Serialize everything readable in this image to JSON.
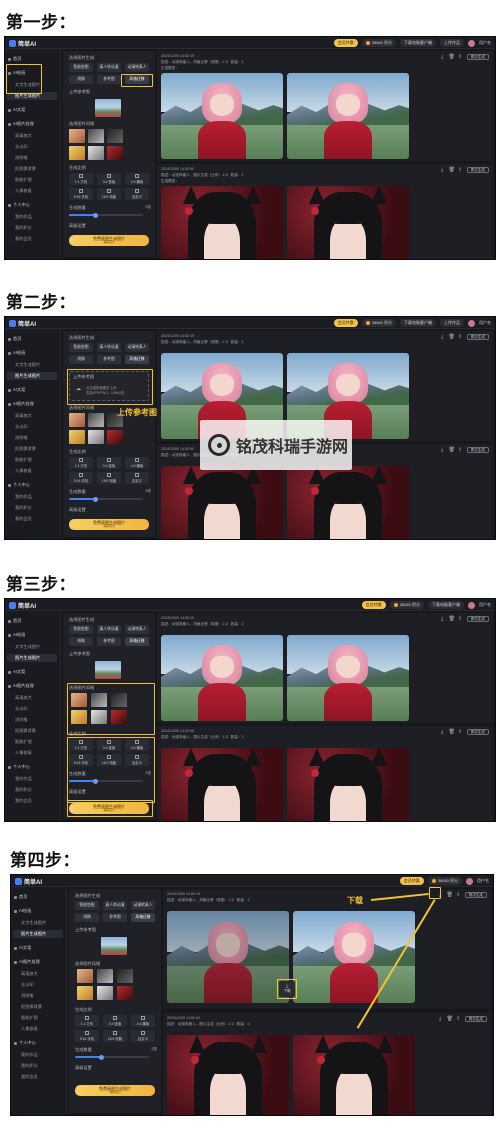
{
  "steps": [
    {
      "title": "第一步："
    },
    {
      "title": "第二步："
    },
    {
      "title": "第三步："
    },
    {
      "title": "第四步："
    }
  ],
  "app": {
    "name": "简单AI",
    "top_pill_membership": "会员特惠",
    "top_credits": "38683 积分",
    "top_download_client": "下载电脑客户端",
    "top_upload": "上传作品",
    "top_user": "用户名"
  },
  "sidebar": {
    "items": [
      {
        "label": "首页"
      },
      {
        "label": "AI绘画"
      },
      {
        "label": "文字生成图片"
      },
      {
        "label": "图片生成图片"
      },
      {
        "label": "AI文案"
      },
      {
        "label": "AI图片处理"
      },
      {
        "label": "高清放大"
      },
      {
        "label": "去水印"
      },
      {
        "label": "消除笔"
      },
      {
        "label": "抠图换背景"
      },
      {
        "label": "智能扩图"
      },
      {
        "label": "人像修复"
      },
      {
        "label": "个人中心"
      },
      {
        "label": "我的作品"
      },
      {
        "label": "我的积分"
      },
      {
        "label": "我的会员"
      }
    ]
  },
  "panel": {
    "section_title": "选择图片生成",
    "chips": [
      "智能垫图",
      "真人转动漫",
      "动漫转真人",
      "线稿",
      "参考图",
      "风格迁移"
    ],
    "ref_label": "上传参考图",
    "upload_hint_1": "点击或拖拽图片上传",
    "upload_hint_2": "支持JPG/PNG，10M以内",
    "style_label": "选择图片风格",
    "ratio_label": "生成比例",
    "ratios": [
      "1:1 方形",
      "3:4 竖版",
      "4:3 横版",
      "9:16 手机",
      "16:9 电脑",
      "自定义"
    ],
    "count_label": "生成数量",
    "count_value": "2张",
    "advanced_label": "高级设置",
    "generate_label": "免费画图生成图片",
    "generate_sub": "消耗积分"
  },
  "results": {
    "card1_time": "2024/12/09 14:52:19",
    "card1_desc": "描述：动漫风格人，风格迁移（原图：1:1）数量：2",
    "card1_extra": "生成模型：",
    "card2_time": "2024/12/09 14:52:00",
    "card2_desc": "描述：动漫风格人，图片生成（比例：1:1）数量：2",
    "card2_extra": "生成模型：",
    "redo_label": "再次生成",
    "download_label": "下载"
  },
  "annotations": {
    "upload_ref": "上传参考图",
    "download": "下载"
  },
  "watermark": {
    "text": "铭茂科瑞手游网"
  },
  "colors": {
    "accent_yellow": "#f2c230",
    "brand_blue": "#4a7df0",
    "bg_dark": "#17181c"
  }
}
